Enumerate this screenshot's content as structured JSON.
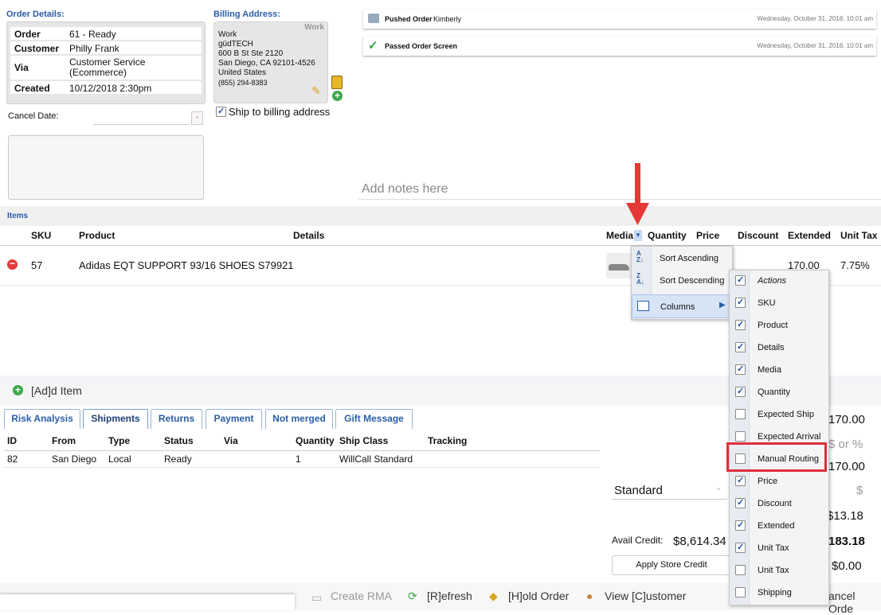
{
  "order": {
    "title": "Order Details:",
    "rows": [
      {
        "k": "Order",
        "v": "61 - Ready"
      },
      {
        "k": "Customer",
        "v": "Philly Frank"
      },
      {
        "k": "Via",
        "v": "Customer Service (Ecommerce)"
      },
      {
        "k": "Created",
        "v": "10/12/2018 2:30pm"
      }
    ],
    "cancel_label": "Cancel Date:"
  },
  "billing": {
    "title": "Billing Address:",
    "tag": "Work",
    "lines": [
      "Work",
      "güdTECH",
      "600 B St Ste 2120",
      "San Diego, CA 92101-4526",
      "United States",
      " (855) 294-8383"
    ],
    "ship_label": "Ship to billing address"
  },
  "activity": [
    {
      "title": "Pushed Order",
      "who": "Kimberly",
      "time": "Wednesday, October 31, 2018, 10:01 am"
    },
    {
      "title": "Passed Order Screen",
      "who": "",
      "time": "Wednesday, October 31, 2018, 10:01 am"
    }
  ],
  "notes_placeholder": "Add notes here",
  "items": {
    "title": "Items",
    "headers": {
      "sku": "SKU",
      "product": "Product",
      "details": "Details",
      "media": "Media",
      "quantity": "Quantity",
      "price": "Price",
      "discount": "Discount",
      "extended": "Extended",
      "unittax": "Unit Tax"
    },
    "row": {
      "sku": "57",
      "product": "Adidas EQT SUPPORT 93/16 SHOES S79921",
      "extended": "170.00",
      "tax": "7.75%"
    },
    "add_label": "[Ad]d Item"
  },
  "menu": {
    "sort_asc": "Sort Ascending",
    "sort_desc": "Sort Descending",
    "columns": "Columns"
  },
  "columns": [
    {
      "label": "Actions",
      "checked": true,
      "italic": true
    },
    {
      "label": "SKU",
      "checked": true
    },
    {
      "label": "Product",
      "checked": true
    },
    {
      "label": "Details",
      "checked": true
    },
    {
      "label": "Media",
      "checked": true
    },
    {
      "label": "Quantity",
      "checked": true
    },
    {
      "label": "Expected Ship",
      "checked": false
    },
    {
      "label": "Expected Arrival",
      "checked": false
    },
    {
      "label": "Manual Routing",
      "checked": false,
      "highlight": true
    },
    {
      "label": "Price",
      "checked": true
    },
    {
      "label": "Discount",
      "checked": true
    },
    {
      "label": "Extended",
      "checked": true
    },
    {
      "label": "Unit Tax",
      "checked": true
    },
    {
      "label": "Unit Tax",
      "checked": false
    },
    {
      "label": "Shipping",
      "checked": false
    }
  ],
  "tabs": [
    "Risk Analysis",
    "Shipments",
    "Returns",
    "Payment",
    "Not merged",
    "Gift Message"
  ],
  "shipments": {
    "headers": {
      "id": "ID",
      "from": "From",
      "type": "Type",
      "status": "Status",
      "via": "Via",
      "quantity": "Quantity",
      "shipclass": "Ship Class",
      "tracking": "Tracking"
    },
    "row": {
      "id": "82",
      "from": "San Diego",
      "type": "Local",
      "status": "Ready",
      "quantity": "1",
      "shipclass": "WillCall Standard"
    }
  },
  "totals": {
    "subtotal": "170.00",
    "disc": "$ or %",
    "after": "170.00",
    "shipping_method": "Standard",
    "ship_amt": "$",
    "tax": "$13.18",
    "avail_label": "Avail Credit:",
    "avail": "$8,614.34",
    "total": "183.18",
    "apply": "Apply Store Credit",
    "balance": "$0.00"
  },
  "bottom": {
    "create_rma": "Create RMA",
    "refresh": "[R]efresh",
    "hold": "[H]old Order",
    "view_customer": "View [C]ustomer",
    "cancel": "ancel Orde"
  },
  "colors": {
    "accent": "#2a5ea8",
    "highlight": "#e02d3c",
    "arrow": "#e53935"
  }
}
